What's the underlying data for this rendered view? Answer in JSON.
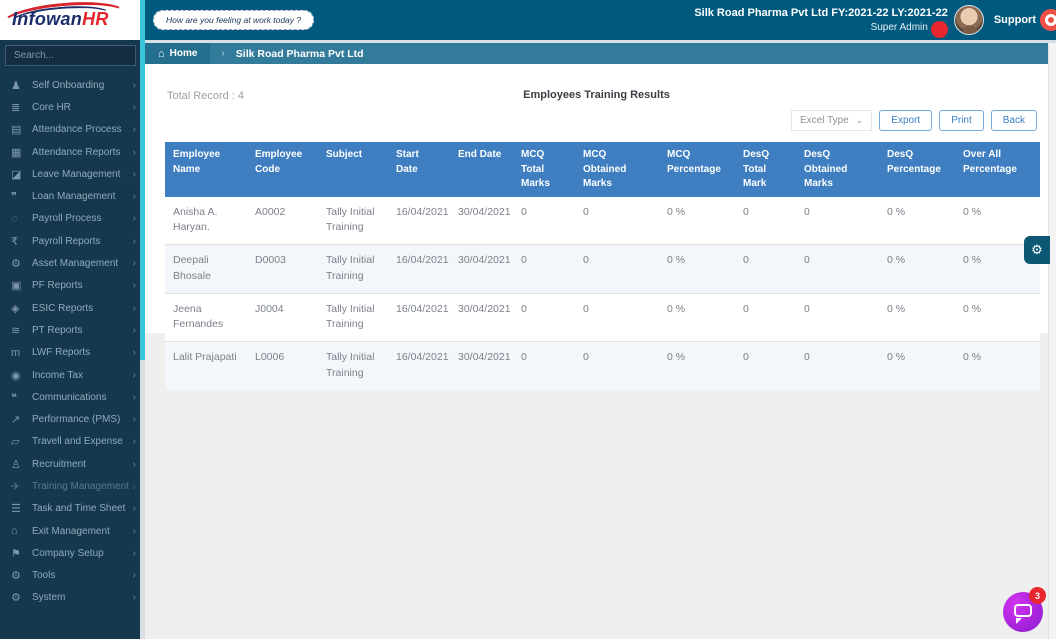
{
  "logo": {
    "part1": "Infowan",
    "part2": "HR"
  },
  "topbar": {
    "mood_pill": "How are you feeling at work today ?",
    "company_line": "Silk Road Pharma Pvt Ltd FY:2021-22 LY:2021-22",
    "user_role": "Super Admin",
    "support_label": "Support"
  },
  "sidebar": {
    "search_placeholder": "Search...",
    "chevron": "›",
    "items": [
      {
        "label": "Self Onboarding",
        "icon": "person-icon",
        "glyph": "♟"
      },
      {
        "label": "Core HR",
        "icon": "database-icon",
        "glyph": "≣"
      },
      {
        "label": "Attendance Process",
        "icon": "clipboard-list-icon",
        "glyph": "▤"
      },
      {
        "label": "Attendance Reports",
        "icon": "id-card-icon",
        "glyph": "▦"
      },
      {
        "label": "Leave Management",
        "icon": "eraser-icon",
        "glyph": "◪"
      },
      {
        "label": "Loan Management",
        "icon": "loan-icon",
        "glyph": "❞"
      },
      {
        "label": "Payroll Process",
        "icon": "spinner-icon",
        "glyph": "◌"
      },
      {
        "label": "Payroll Reports",
        "icon": "rupee-icon",
        "glyph": "₹"
      },
      {
        "label": "Asset Management",
        "icon": "gears-icon",
        "glyph": "⚙"
      },
      {
        "label": "PF Reports",
        "icon": "briefcase-icon",
        "glyph": "▣"
      },
      {
        "label": "ESIC Reports",
        "icon": "diamond-icon",
        "glyph": "◈"
      },
      {
        "label": "PT Reports",
        "icon": "waves-icon",
        "glyph": "≋"
      },
      {
        "label": "LWF Reports",
        "icon": "letter-m-icon",
        "glyph": "m"
      },
      {
        "label": "Income Tax",
        "icon": "bomb-icon",
        "glyph": "◉"
      },
      {
        "label": "Communications",
        "icon": "chat-icon",
        "glyph": "❝"
      },
      {
        "label": "Performance (PMS)",
        "icon": "chart-icon",
        "glyph": "↗"
      },
      {
        "label": "Travell and Expense",
        "icon": "map-icon",
        "glyph": "▱"
      },
      {
        "label": "Recruitment",
        "icon": "person-plus-icon",
        "glyph": "♙"
      },
      {
        "label": "Training Management",
        "icon": "paper-plane-icon",
        "glyph": "✈",
        "active": true
      },
      {
        "label": "Task and Time Sheet",
        "icon": "tasks-icon",
        "glyph": "☰"
      },
      {
        "label": "Exit Management",
        "icon": "home-icon",
        "glyph": "⌂"
      },
      {
        "label": "Company Setup",
        "icon": "flag-icon",
        "glyph": "⚑"
      },
      {
        "label": "Tools",
        "icon": "gear-icon",
        "glyph": "⚙"
      },
      {
        "label": "System",
        "icon": "gear-icon",
        "glyph": "⚙"
      }
    ]
  },
  "breadcrumb": {
    "home_icon": "⌂",
    "home": "Home",
    "separator": "›",
    "current": "Silk Road Pharma Pvt Ltd"
  },
  "content": {
    "total_record": "Total Record : 4",
    "title": "Employees Training Results",
    "excel_type_label": "Excel Type",
    "excel_chevron": "⌄",
    "export_label": "Export",
    "print_label": "Print",
    "back_label": "Back"
  },
  "table": {
    "headers": [
      "Employee Name",
      "Employee Code",
      "Subject",
      "Start Date",
      "End Date",
      "MCQ Total Marks",
      "MCQ Obtained Marks",
      "MCQ Percentage",
      "DesQ Total Mark",
      "DesQ Obtained Marks",
      "DesQ Percentage",
      "Over All Percentage"
    ],
    "rows": [
      [
        "Anisha A. Haryan.",
        "A0002",
        "Tally Initial Training",
        "16/04/2021",
        "30/04/2021",
        "0",
        "0",
        "0 %",
        "0",
        "0",
        "0 %",
        "0 %"
      ],
      [
        "Deepali Bhosale",
        "D0003",
        "Tally Initial Training",
        "16/04/2021",
        "30/04/2021",
        "0",
        "0",
        "0 %",
        "0",
        "0",
        "0 %",
        "0 %"
      ],
      [
        "Jeena Fernandes",
        "J0004",
        "Tally Initial Training",
        "16/04/2021",
        "30/04/2021",
        "0",
        "0",
        "0 %",
        "0",
        "0",
        "0 %",
        "0 %"
      ],
      [
        "Lalit Prajapati",
        "L0006",
        "Tally Initial Training",
        "16/04/2021",
        "30/04/2021",
        "0",
        "0",
        "0 %",
        "0",
        "0",
        "0 %",
        "0 %"
      ]
    ]
  },
  "floating": {
    "gear_glyph": "⚙",
    "chat_badge": "3"
  },
  "colors": {
    "topbar": "#005A80",
    "breadcrumb": "#337B9B",
    "sidebar": "#16384F",
    "sidebar_scroll_thumb": "#39C5DA",
    "table_header": "#3E7EC1",
    "table_alt_row": "#f3f7fb",
    "button_blue": "#3b7fc4",
    "gear_fab": "#0C5774",
    "badge_red": "#e8262d",
    "chat_purple": "#a924dd",
    "logo_navy": "#1b2d6b",
    "logo_red": "#e4252b"
  }
}
